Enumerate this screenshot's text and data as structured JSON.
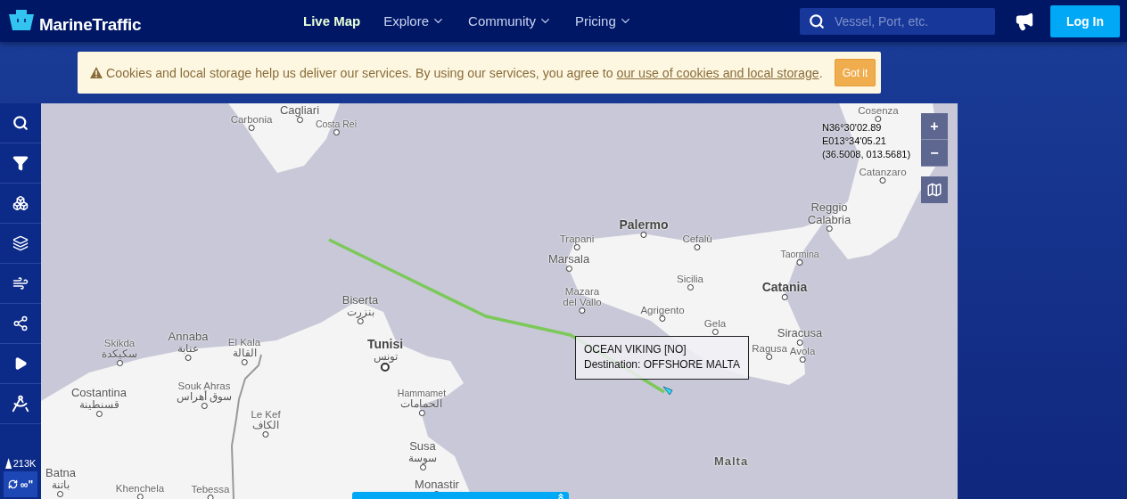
{
  "header": {
    "logo": "MarineTraffic",
    "nav": [
      {
        "label": "Live Map",
        "selected": true,
        "dropdown": false
      },
      {
        "label": "Explore",
        "selected": false,
        "dropdown": true
      },
      {
        "label": "Community",
        "selected": false,
        "dropdown": true
      },
      {
        "label": "Pricing",
        "selected": false,
        "dropdown": true
      }
    ],
    "search": {
      "placeholder": "Vessel, Port, etc."
    },
    "login": "Log In"
  },
  "cookie_banner": {
    "text": "Cookies and local storage help us deliver our services. By using our services, you agree to",
    "link": "our use of cookies and local storage",
    "suffix": ".",
    "button": "Got it"
  },
  "sidebar": {
    "vessel_count": "213K",
    "refresh": "∞\""
  },
  "map": {
    "places": [
      {
        "name": "Carbonia",
        "kind": "minor"
      },
      {
        "name": "Cagliari",
        "kind": "major"
      },
      {
        "name": "Cosenza",
        "kind": "minor"
      },
      {
        "name": "Costa Rei",
        "kind": "small"
      },
      {
        "name": "Catanzaro",
        "kind": "minor"
      },
      {
        "name": "Palermo",
        "kind": "big"
      },
      {
        "name": "Reggio\nCalabria",
        "kind": "major"
      },
      {
        "name": "Trapani",
        "kind": "minor"
      },
      {
        "name": "Cefalù",
        "kind": "minor"
      },
      {
        "name": "Marsala",
        "kind": "major"
      },
      {
        "name": "Taormina",
        "kind": "small"
      },
      {
        "name": "Sicilia",
        "kind": "minor"
      },
      {
        "name": "Biserta",
        "native": "بنزرت",
        "kind": "major"
      },
      {
        "name": "Mazara\ndel Vallo",
        "kind": "minor"
      },
      {
        "name": "Catania",
        "kind": "big"
      },
      {
        "name": "Agrigento",
        "kind": "minor"
      },
      {
        "name": "Gela",
        "kind": "minor"
      },
      {
        "name": "Skikda",
        "native": "سكيكدة",
        "kind": "minor"
      },
      {
        "name": "Annaba",
        "native": "عنابة",
        "kind": "major"
      },
      {
        "name": "El Kala",
        "native": "القالة",
        "kind": "minor"
      },
      {
        "name": "Tunisi",
        "native": "تونس",
        "kind": "capital"
      },
      {
        "name": "Siracusa",
        "kind": "major"
      },
      {
        "name": "Ragusa",
        "kind": "minor"
      },
      {
        "name": "Avola",
        "kind": "minor"
      },
      {
        "name": "Costantina",
        "native": "قسنطينة",
        "kind": "major"
      },
      {
        "name": "Souk Ahras",
        "native": "سوق أهراس",
        "kind": "minor"
      },
      {
        "name": "Hammamet",
        "native": "الحمامات",
        "kind": "small"
      },
      {
        "name": "Le Kef",
        "native": "الكاف",
        "kind": "minor"
      },
      {
        "name": "Susa",
        "native": "سوسة",
        "kind": "major"
      },
      {
        "name": "Malta",
        "kind": "country"
      },
      {
        "name": "Batna",
        "native": "باتنة",
        "kind": "major"
      },
      {
        "name": "Khenchela",
        "kind": "minor"
      },
      {
        "name": "Tebessa",
        "kind": "minor"
      },
      {
        "name": "Monastir",
        "kind": "major"
      }
    ],
    "coordinates": [
      "N36°30'02.89",
      "E013°34'05.21",
      "(36.5008, 013.5681)"
    ],
    "zoom_in": "+",
    "zoom_out": "−",
    "vessel_tooltip": {
      "name": "OCEAN VIKING [NO]",
      "destination": "Destination: OFFSHORE MALTA"
    }
  }
}
